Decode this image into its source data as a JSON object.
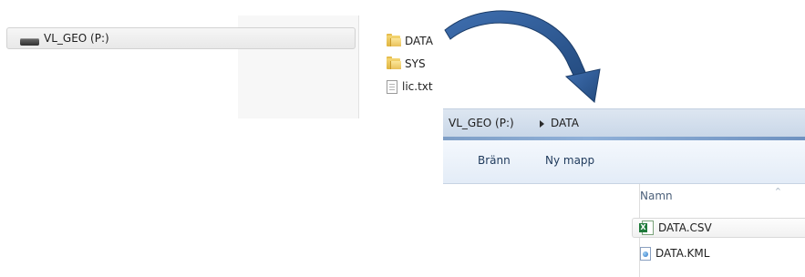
{
  "drive": {
    "label": "VL_GEO (P:)",
    "icon": "drive-icon"
  },
  "top_folder": {
    "items": [
      {
        "label": "DATA",
        "icon": "folder-icon"
      },
      {
        "label": "SYS",
        "icon": "folder-icon"
      },
      {
        "label": "lic.txt",
        "icon": "text-file-icon"
      }
    ]
  },
  "explorer": {
    "breadcrumb": {
      "root": "VL_GEO (P:)",
      "current": "DATA"
    },
    "toolbar": {
      "burn_label": "Bränn",
      "new_folder_label": "Ny mapp"
    },
    "columns": {
      "name": "Namn"
    },
    "files": [
      {
        "label": "DATA.CSV",
        "icon": "excel-icon"
      },
      {
        "label": "DATA.KML",
        "icon": "kml-icon"
      }
    ]
  },
  "colors": {
    "arrow": "#2e5a94",
    "address_bar": "#c9d7e8",
    "toolbar": "#e3ecf7"
  }
}
